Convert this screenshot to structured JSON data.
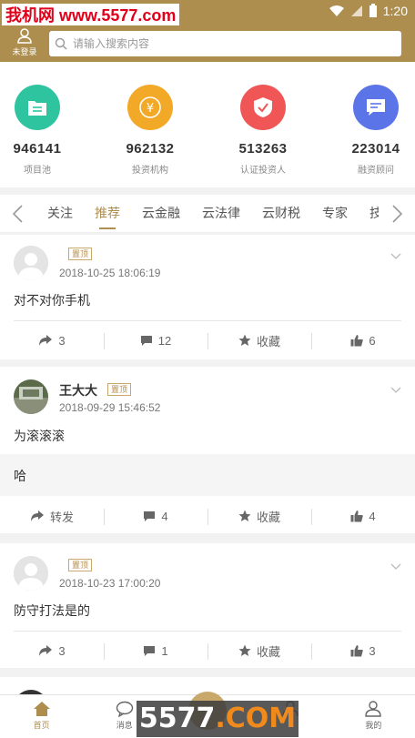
{
  "statusbar": {
    "watermark": "我机网 www.5577.com",
    "time": "1:20"
  },
  "header": {
    "login_label": "未登录",
    "search_placeholder": "请输入搜索内容"
  },
  "stats": [
    {
      "value": "946141",
      "label": "项目池",
      "color": "#2fc4a0",
      "icon": "folder-icon"
    },
    {
      "value": "962132",
      "label": "投资机构",
      "color": "#f3a928",
      "icon": "yen-icon"
    },
    {
      "value": "513263",
      "label": "认证投资人",
      "color": "#f05656",
      "icon": "shield-check-icon"
    },
    {
      "value": "223014",
      "label": "融资顾问",
      "color": "#5b74e8",
      "icon": "message-icon"
    }
  ],
  "tabs": [
    "关注",
    "推荐",
    "云金融",
    "云法律",
    "云财税",
    "专家",
    "技"
  ],
  "active_tab": "推荐",
  "posts": [
    {
      "name": "",
      "badge": "置顶",
      "time": "2018-10-25 18:06:19",
      "content": "对不对你手机",
      "sub": "",
      "share": "3",
      "comments": "12",
      "fav": "收藏",
      "likes": "6"
    },
    {
      "name": "王大大",
      "badge": "置顶",
      "time": "2018-09-29 15:46:52",
      "content": "为滚滚滚",
      "sub": "哈",
      "share": "转发",
      "comments": "4",
      "fav": "收藏",
      "likes": "4"
    },
    {
      "name": "",
      "badge": "置顶",
      "time": "2018-10-23 17:00:20",
      "content": "防守打法是的",
      "sub": "",
      "share": "3",
      "comments": "1",
      "fav": "收藏",
      "likes": "3"
    }
  ],
  "bottomnav": [
    "首页",
    "消息",
    "",
    "",
    "我的"
  ],
  "watermark_bottom": {
    "digits": "5577",
    "dot_com": ".COM"
  },
  "colors": {
    "brand": "#ad8e4f",
    "badge": "#b48f4c"
  }
}
